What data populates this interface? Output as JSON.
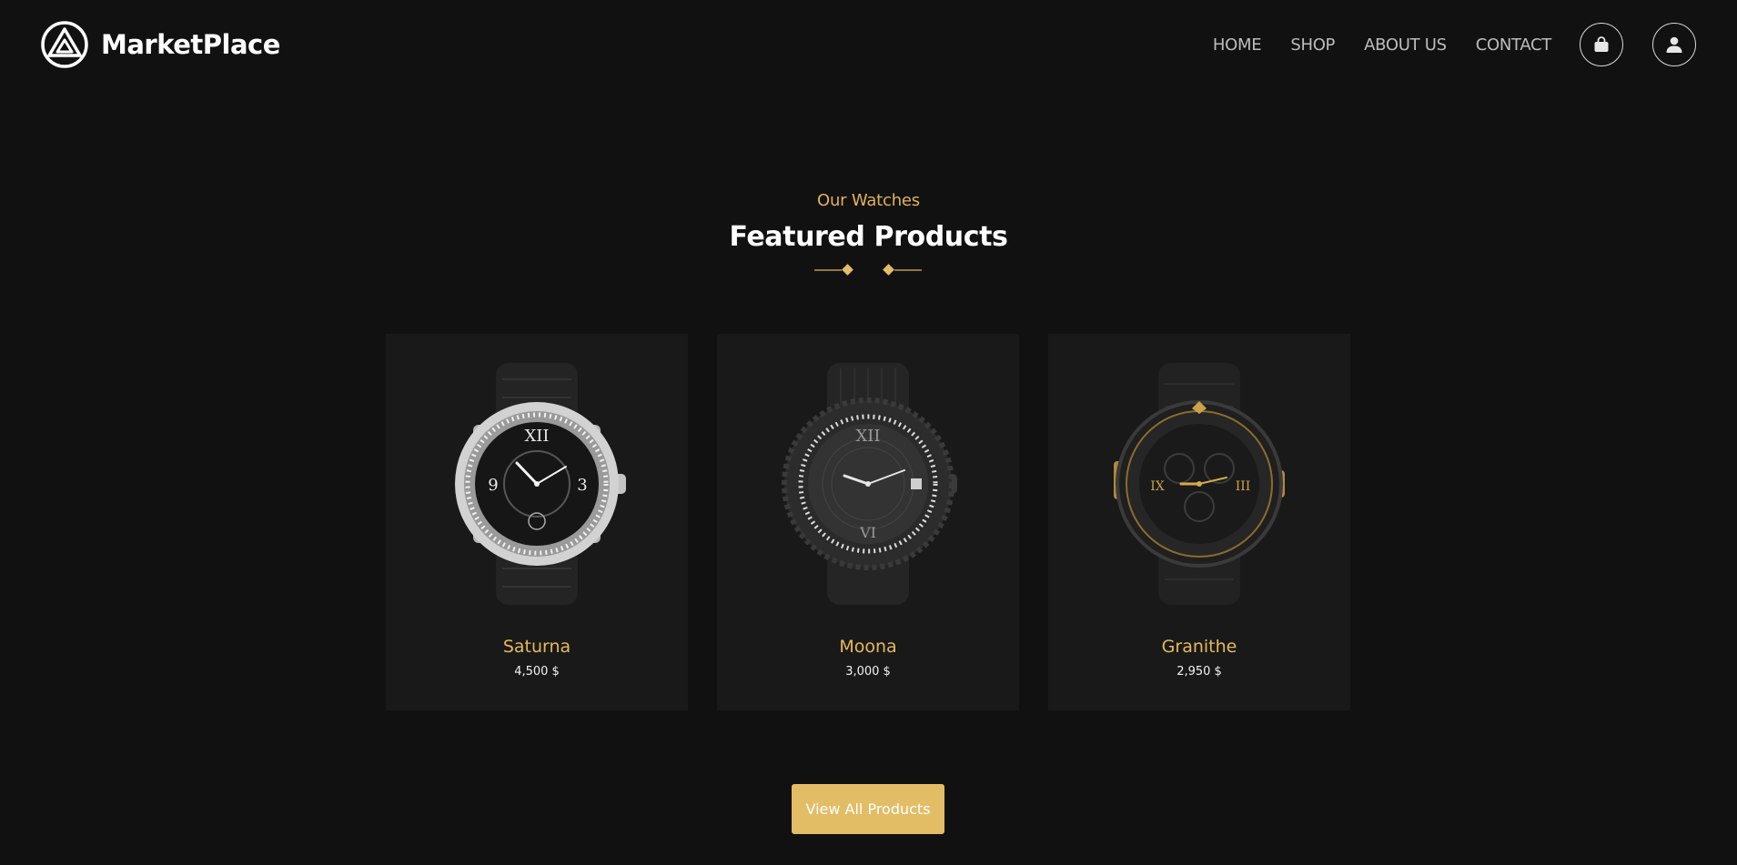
{
  "brand": {
    "name": "MarketPlace",
    "logo_icon": "triangle-circle-logo-icon"
  },
  "nav": {
    "links": [
      {
        "label": "HOME"
      },
      {
        "label": "SHOP"
      },
      {
        "label": "ABOUT US"
      },
      {
        "label": "CONTACT"
      }
    ],
    "cart_icon": "shopping-bag-icon",
    "user_icon": "user-icon"
  },
  "section": {
    "eyebrow": "Our Watches",
    "title": "Featured Products"
  },
  "products": [
    {
      "name": "Saturna",
      "price": "4,500 $",
      "image_icon": "silver-watch-image"
    },
    {
      "name": "Moona",
      "price": "3,000 $",
      "image_icon": "black-diamond-watch-image"
    },
    {
      "name": "Granithe",
      "price": "2,950 $",
      "image_icon": "black-gold-watch-image"
    }
  ],
  "cta": {
    "label": "View All Products"
  },
  "colors": {
    "background": "#111111",
    "card": "#191919",
    "accent": "#e3bd66",
    "accent_text": "#e0b25a",
    "nav_text": "#bdbdbd"
  }
}
